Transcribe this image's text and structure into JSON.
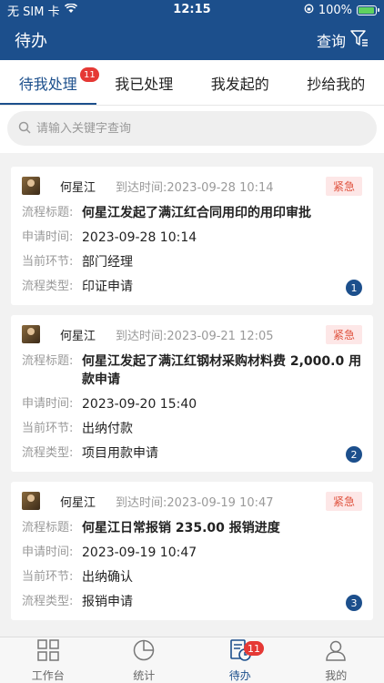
{
  "status_bar": {
    "carrier": "无 SIM 卡",
    "time": "12:15",
    "battery": "100%"
  },
  "header": {
    "title": "待办",
    "query_label": "查询"
  },
  "tabs": [
    {
      "label": "待我处理",
      "badge": "11",
      "active": true
    },
    {
      "label": "我已处理"
    },
    {
      "label": "我发起的"
    },
    {
      "label": "抄给我的"
    }
  ],
  "search": {
    "placeholder": "请输入关键字查询"
  },
  "cards": [
    {
      "name": "何星江",
      "arrive": "到达时间:2023-09-28 10:14",
      "tag": "紧急",
      "flow_title_label": "流程标题:",
      "flow_title": "何星江发起了满江红合同用印的用印审批",
      "apply_time_label": "申请时间:",
      "apply_time": "2023-09-28 10:14",
      "node_label": "当前环节:",
      "node": "部门经理",
      "type_label": "流程类型:",
      "type": "印证申请",
      "seq": "1"
    },
    {
      "name": "何星江",
      "arrive": "到达时间:2023-09-21 12:05",
      "tag": "紧急",
      "flow_title_label": "流程标题:",
      "flow_title": "何星江发起了满江红钢材采购材料费 2,000.0 用款申请",
      "apply_time_label": "申请时间:",
      "apply_time": "2023-09-20 15:40",
      "node_label": "当前环节:",
      "node": "出纳付款",
      "type_label": "流程类型:",
      "type": "项目用款申请",
      "seq": "2"
    },
    {
      "name": "何星江",
      "arrive": "到达时间:2023-09-19 10:47",
      "tag": "紧急",
      "flow_title_label": "流程标题:",
      "flow_title": "何星江日常报销 235.00 报销进度",
      "apply_time_label": "申请时间:",
      "apply_time": "2023-09-19 10:47",
      "node_label": "当前环节:",
      "node": "出纳确认",
      "type_label": "流程类型:",
      "type": "报销申请",
      "seq": "3"
    }
  ],
  "tabbar": [
    {
      "label": "工作台",
      "icon": "grid-icon"
    },
    {
      "label": "统计",
      "icon": "pie-chart-icon"
    },
    {
      "label": "待办",
      "icon": "todo-clock-icon",
      "badge": "11",
      "active": true
    },
    {
      "label": "我的",
      "icon": "person-icon"
    }
  ],
  "colors": {
    "brand": "#1c4f8c",
    "badge": "#e53935",
    "urgent_text": "#e0533f",
    "urgent_bg": "#fde7e7"
  }
}
